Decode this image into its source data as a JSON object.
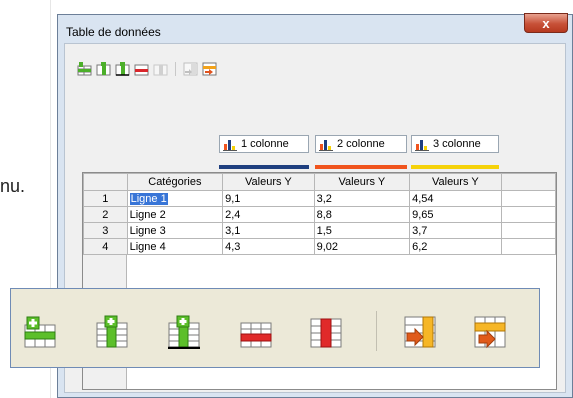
{
  "background": {
    "partial_text": "nu."
  },
  "dialog": {
    "title": "Table de données",
    "close_glyph": "x"
  },
  "toolbar_small": {
    "icons": [
      "insert-row-icon",
      "insert-column-icon",
      "insert-text-column-icon",
      "delete-row-icon",
      "delete-column-icon",
      "move-row-down-icon",
      "move-column-right-icon"
    ]
  },
  "series": [
    {
      "label": "1 colonne",
      "color": "#1f3f7f"
    },
    {
      "label": "2 colonne",
      "color": "#f0541e"
    },
    {
      "label": "3 colonne",
      "color": "#f5d20a"
    }
  ],
  "table": {
    "headers": [
      "",
      "Catégories",
      "Valeurs Y",
      "Valeurs Y",
      "Valeurs Y"
    ],
    "rows": [
      [
        "1",
        "Ligne 1",
        "9,1",
        "3,2",
        "4,54"
      ],
      [
        "2",
        "Ligne 2",
        "2,4",
        "8,8",
        "9,65"
      ],
      [
        "3",
        "Ligne 3",
        "3,1",
        "1,5",
        "3,7"
      ],
      [
        "4",
        "Ligne 4",
        "4,3",
        "9,02",
        "6,2"
      ]
    ]
  },
  "colors": {
    "add_green": "#4caf2a",
    "delete_red": "#d9262c",
    "move_orange": "#f2a21a"
  }
}
